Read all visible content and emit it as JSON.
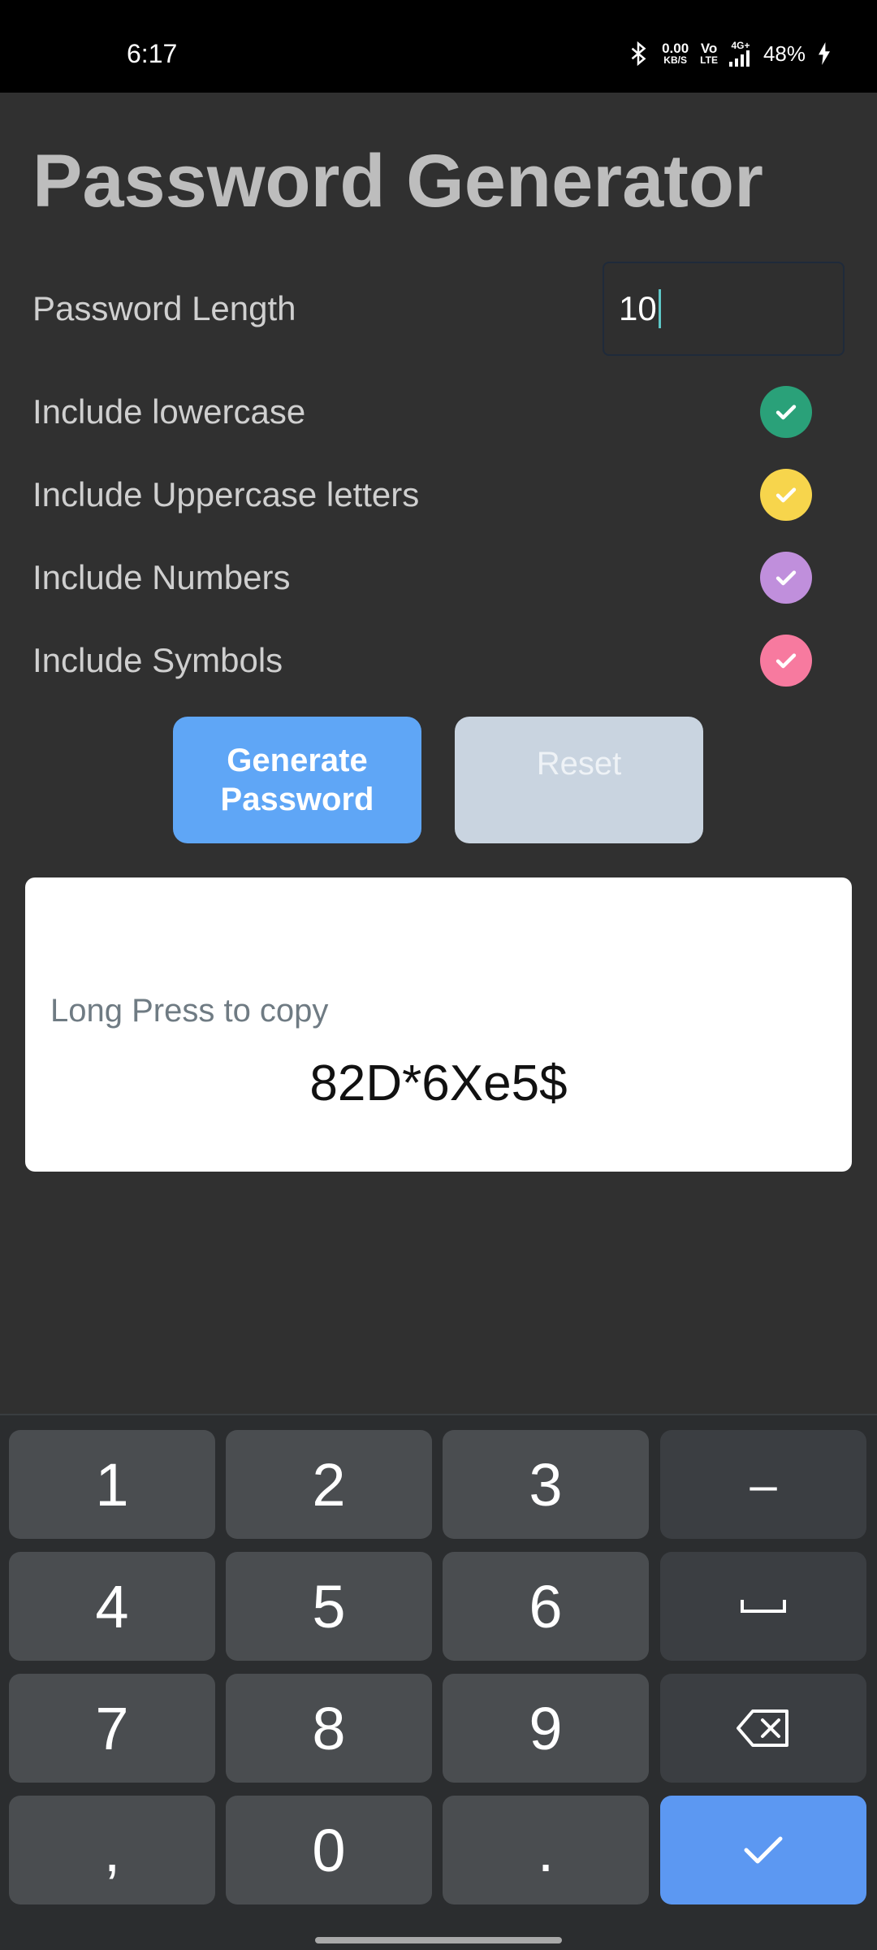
{
  "status_bar": {
    "time": "6:17",
    "net_speed": "0.00",
    "net_unit": "KB/S",
    "volte_top": "Vo",
    "volte_bottom": "LTE",
    "signal": "4G+",
    "battery": "48%"
  },
  "app": {
    "title": "Password Generator",
    "length_label": "Password Length",
    "length_value": "10",
    "options": [
      {
        "label": "Include lowercase",
        "color": "#2aa179",
        "checked": true
      },
      {
        "label": "Include Uppercase letters",
        "color": "#f7d54c",
        "checked": true
      },
      {
        "label": "Include Numbers",
        "color": "#c08fdc",
        "checked": true
      },
      {
        "label": "Include Symbols",
        "color": "#f77a9f",
        "checked": true
      }
    ],
    "generate_line1": "Generate",
    "generate_line2": "Password",
    "reset_label": "Reset",
    "copy_hint": "Long Press to copy",
    "password": "82D*6Xe5$"
  },
  "keyboard": {
    "keys": [
      "1",
      "2",
      "3",
      "–",
      "4",
      "5",
      "6",
      "space",
      "7",
      "8",
      "9",
      "backspace",
      ",",
      "0",
      ".",
      "done"
    ]
  }
}
